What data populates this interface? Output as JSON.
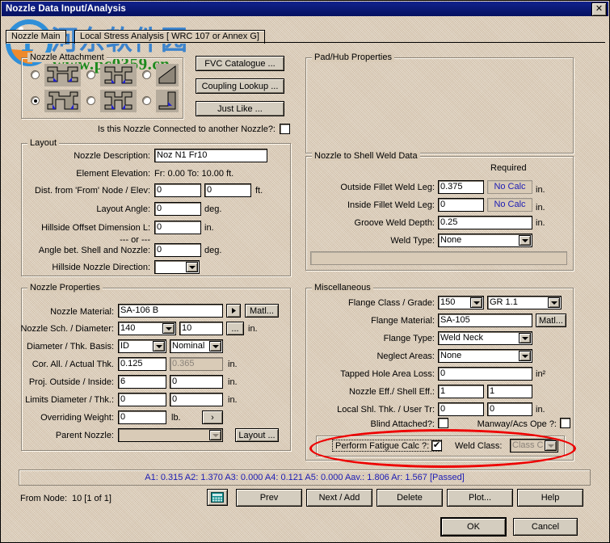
{
  "window": {
    "title": "Nozzle Data Input/Analysis",
    "close_label": "✕"
  },
  "watermark": {
    "chinese": "河东软件园",
    "url": "www.pc0359.cn"
  },
  "tabs": [
    {
      "label": "Nozzle Main",
      "selected": true
    },
    {
      "label": "Local Stress Analysis [ WRC 107 or Annex G]",
      "selected": false
    }
  ],
  "nozzle_attachment": {
    "legend": "Nozzle Attachment",
    "options": [
      {
        "id": "opt1",
        "selected": false
      },
      {
        "id": "opt2",
        "selected": false
      },
      {
        "id": "opt3",
        "selected": false
      },
      {
        "id": "opt4",
        "selected": true
      },
      {
        "id": "opt5",
        "selected": false
      },
      {
        "id": "opt6",
        "selected": false
      }
    ],
    "buttons": [
      "FVC Catalogue ...",
      "Coupling Lookup ...",
      "Just Like ..."
    ],
    "connected_label": "Is this Nozzle Connected to another Nozzle?:",
    "connected_checked": false
  },
  "layout": {
    "legend": "Layout",
    "nozzle_description_label": "Nozzle Description:",
    "nozzle_description": "Noz N1 Fr10",
    "element_elevation_label": "Element Elevation:",
    "element_elevation": "Fr: 0.00 To: 10.00 ft.",
    "dist_label": "Dist. from 'From' Node / Elev:",
    "dist_1": "0",
    "dist_2": "0",
    "dist_unit": "ft.",
    "layout_angle_label": "Layout Angle:",
    "layout_angle": "0",
    "layout_angle_unit": "deg.",
    "hillside_offset_label": "Hillside Offset Dimension L:",
    "hillside_offset": "0",
    "hillside_offset_unit": "in.",
    "or_label": "--- or ---",
    "angle_shell_label": "Angle bet. Shell and Nozzle:",
    "angle_shell": "0",
    "angle_shell_unit": "deg.",
    "hillside_dir_label": "Hillside Nozzle Direction:",
    "hillside_dir": ""
  },
  "nozzle_properties": {
    "legend": "Nozzle Properties",
    "material_label": "Nozzle Material:",
    "material": "SA-106 B",
    "material_btn": "Matl...",
    "sch_dia_label": "Nozzle Sch. / Diameter:",
    "sch": "140",
    "diameter": "10",
    "sch_dia_browse": "...",
    "sch_dia_unit": "in.",
    "basis_label": "Diameter / Thk. Basis:",
    "basis_1": "ID",
    "basis_2": "Nominal",
    "cor_label": "Cor. All. / Actual Thk.",
    "cor_all": "0.125",
    "actual_thk": "0.365",
    "cor_unit": "in.",
    "proj_label": "Proj. Outside / Inside:",
    "proj_outside": "6",
    "proj_inside": "0",
    "proj_unit": "in.",
    "limits_label": "Limits Diameter / Thk.:",
    "limits_dia": "0",
    "limits_thk": "0",
    "limits_unit": "in.",
    "overriding_label": "Overriding Weight:",
    "overriding_weight": "0",
    "overriding_unit": "lb.",
    "overriding_btn": "›",
    "parent_label": "Parent Nozzle:",
    "parent_nozzle": "",
    "parent_btn": "Layout ..."
  },
  "pad_hub": {
    "legend": "Pad/Hub Properties"
  },
  "weld_data": {
    "legend": "Nozzle to Shell Weld Data",
    "required_label": "Required",
    "outside_label": "Outside Fillet Weld Leg:",
    "outside_value": "0.375",
    "outside_required": "No Calc",
    "outside_unit": "in.",
    "inside_label": "Inside Fillet Weld Leg:",
    "inside_value": "0",
    "inside_required": "No Calc",
    "inside_unit": "in.",
    "groove_label": "Groove Weld Depth:",
    "groove_value": "0.25",
    "groove_unit": "in.",
    "weld_type_label": "Weld Type:",
    "weld_type": "None"
  },
  "miscellaneous": {
    "legend": "Miscellaneous",
    "flange_class_label": "Flange Class / Grade:",
    "flange_class": "150",
    "flange_grade": "GR 1.1",
    "flange_material_label": "Flange Material:",
    "flange_material": "SA-105",
    "flange_material_btn": "Matl...",
    "flange_type_label": "Flange Type:",
    "flange_type": "Weld Neck",
    "neglect_areas_label": "Neglect Areas:",
    "neglect_areas": "None",
    "tapped_hole_label": "Tapped Hole Area Loss:",
    "tapped_hole": "0",
    "tapped_hole_unit": "in²",
    "eff_label": "Nozzle Eff./ Shell Eff.:",
    "nozzle_eff": "1",
    "shell_eff": "1",
    "local_thk_label": "Local Shl. Thk. / User Tr:",
    "local_thk": "0",
    "user_tr": "0",
    "local_thk_unit": "in.",
    "blind_label": "Blind Attached?:",
    "blind_checked": false,
    "manway_label": "Manway/Acs Ope ?:",
    "manway_checked": false,
    "fatigue_label": "Perform Fatigue Calc ?:",
    "fatigue_checked": true,
    "fatigue_check_glyph": "✔",
    "weld_class_label": "Weld Class:",
    "weld_class": "Class C",
    "highlight_color": "#ee0000"
  },
  "status_bar": {
    "text": "A1:  0.315    A2:  1.370    A3:  0.000    A4:  0.121    A5:  0.000        Aav.:  1.806    Ar:  1.567 [Passed]",
    "values": {
      "A1": "0.315",
      "A2": "1.370",
      "A3": "0.000",
      "A4": "0.121",
      "A5": "0.000",
      "Aav": "1.806",
      "Ar": "1.567",
      "result": "[Passed]"
    },
    "color": "#1b1bb4"
  },
  "navbar": {
    "from_node_label": "From Node:",
    "from_node_value": "10  [1 of 1]",
    "calc_icon": "calculator-icon",
    "buttons": [
      "Prev",
      "Next / Add",
      "Delete",
      "Plot...",
      "Help"
    ]
  },
  "footer": {
    "ok": "OK",
    "cancel": "Cancel"
  }
}
